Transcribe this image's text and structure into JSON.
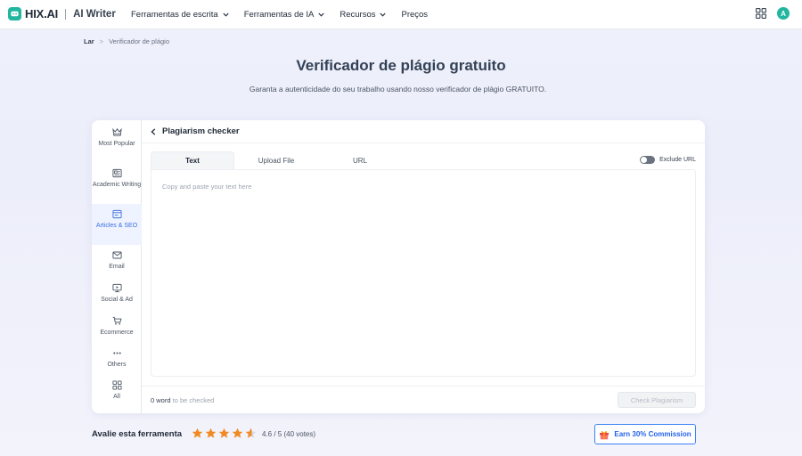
{
  "brand": {
    "name": "HIX.AI",
    "product": "AI Writer",
    "accent_color": "#22b6a1"
  },
  "nav": {
    "items": [
      {
        "label": "Ferramentas de escrita",
        "dropdown": true
      },
      {
        "label": "Ferramentas de IA",
        "dropdown": true
      },
      {
        "label": "Recursos",
        "dropdown": true
      },
      {
        "label": "Preços",
        "dropdown": false
      }
    ],
    "avatar_initial": "A"
  },
  "breadcrumb": {
    "home": "Lar",
    "current": "Verificador de plágio"
  },
  "page": {
    "title": "Verificador de plágio gratuito",
    "subtitle": "Garanta a autenticidade do seu trabalho usando nosso verificador de plágio GRATUITO."
  },
  "sidebar": {
    "items": [
      {
        "label": "Most Popular",
        "icon": "crown-icon",
        "active": false
      },
      {
        "label": "Academic Writing",
        "icon": "newspaper-icon",
        "active": false
      },
      {
        "label": "Articles & SEO",
        "icon": "browser-icon",
        "active": true
      },
      {
        "label": "Email",
        "icon": "mail-icon",
        "active": false
      },
      {
        "label": "Social & Ad",
        "icon": "monitor-icon",
        "active": false
      },
      {
        "label": "Ecommerce",
        "icon": "cart-icon",
        "active": false
      },
      {
        "label": "Others",
        "icon": "dots-icon",
        "active": false
      },
      {
        "label": "All",
        "icon": "grid-icon",
        "active": false
      }
    ]
  },
  "tool": {
    "title": "Plagiarism checker",
    "tabs": [
      "Text",
      "Upload File",
      "URL"
    ],
    "active_tab": "Text",
    "exclude_url_label": "Exclude URL",
    "exclude_url_enabled": false,
    "textarea": {
      "value": "",
      "placeholder": "Copy and paste your text here"
    },
    "word_count": "0 word",
    "word_count_suffix": "to be checked",
    "check_button": "Check Plagiarism"
  },
  "rating": {
    "label": "Avalie esta ferramenta",
    "score": 4.6,
    "text": "4.6 / 5 (40 votes)",
    "star_color": "#f08a24"
  },
  "earn": {
    "label": "Earn 30% Commission",
    "icon": "gift-icon",
    "color": "#2563eb"
  }
}
